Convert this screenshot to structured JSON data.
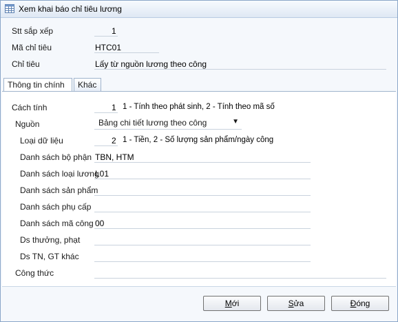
{
  "window": {
    "title": "Xem khai báo chỉ tiêu lương",
    "icon": "table-icon"
  },
  "header_fields": {
    "stt_label": "Stt sắp xếp",
    "stt_value": "1",
    "ma_label": "Mã chỉ tiêu",
    "ma_value": "HTC01",
    "chitieu_label": "Chỉ tiêu",
    "chitieu_value": "Lấy từ nguồn lương theo công"
  },
  "tabs": [
    {
      "label": "Thông tin chính",
      "active": true
    },
    {
      "label": "Khác",
      "active": false
    }
  ],
  "main": {
    "cachtinh_label": "Cách tính",
    "cachtinh_value": "1",
    "cachtinh_hint": "1 - Tính theo phát sinh, 2 - Tính theo mã số",
    "nguon_label": "Nguồn",
    "nguon_value": "Bảng chi tiết lương theo công",
    "loai_label": "Loại dữ liệu",
    "loai_value": "2",
    "loai_hint": "1 - Tiền, 2 - Số lượng sản phẩm/ngày công",
    "bophan_label": "Danh sách bộ phận",
    "bophan_value": "TBN, HTM",
    "loailuong_label": "Danh sách loại lương",
    "loailuong_value": "L01",
    "sanpham_label": "Danh sách sản phẩm",
    "sanpham_value": "",
    "phucap_label": "Danh sách phụ cấp",
    "phucap_value": "",
    "macong_label": "Danh sách mã công",
    "macong_value": "00",
    "thuong_label": "Ds thưởng, phạt",
    "thuong_value": "",
    "tn_label": "Ds TN, GT khác",
    "tn_value": "",
    "congthuc_label": "Công thức",
    "congthuc_value": ""
  },
  "buttons": {
    "new_accel": "M",
    "new_rest": "ới",
    "edit_accel": "S",
    "edit_rest": "ửa",
    "close_accel": "Đ",
    "close_rest": "óng"
  }
}
